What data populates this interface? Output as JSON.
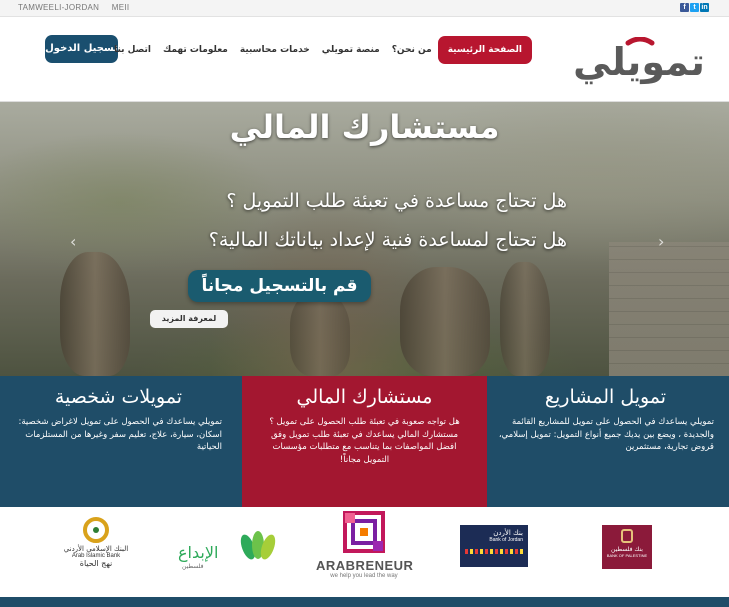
{
  "topbar": {
    "site_label": "TAMWEELI-JORDAN",
    "extra_label": "MEII",
    "social": [
      {
        "icon": "facebook-icon",
        "glyph": "f",
        "color": "#3b5998"
      },
      {
        "icon": "twitter-icon",
        "glyph": "t",
        "color": "#1da1f2"
      },
      {
        "icon": "linkedin-icon",
        "glyph": "in",
        "color": "#0077b5"
      }
    ]
  },
  "header": {
    "logo_text": "تمويلي",
    "nav": {
      "home": "الصفحة الرئيسية",
      "about": "من نحن؟",
      "platform": "منصة تمويلي",
      "accounting": "خدمات محاسبية",
      "info": "معلومات تهمك",
      "contact": "اتصل بنا"
    },
    "login": "تسجيل الدخول"
  },
  "hero": {
    "title": "مستشارك المالي",
    "question1": "هل تحتاج مساعدة في تعبئة طلب التمويل ؟",
    "question2": "هل تحتاج لمساعدة فنية لإعداد بياناتك المالية؟",
    "cta": "قم بالتسجيل مجاناً",
    "more": "لمعرفة المزيد",
    "prev_arrow": "‹",
    "next_arrow": "›"
  },
  "panels": {
    "projects": {
      "title": "تمويل المشاريع",
      "text": "تمويلي يساعدك في الحصول على تمويل للمشاريع القائمة والجديدة ، ويضع بين يديك جميع أنواع التمويل: تمويل إسلامي، قروض تجارية، مستثمرين"
    },
    "advisor": {
      "title": "مستشارك المالي",
      "text": "هل تواجه صعوبة في تعبئة طلب الحصول على تمويل ؟ مستشارك المالي يساعدك في تعبئة طلب تمويل وفق افضل المواصفات بما يتناسب مع متطلبات مؤسسات التمويل مجاناً!"
    },
    "personal": {
      "title": "تمويلات شخصية",
      "text": "تمويلي يساعدك في الحصول على تمويل لاغراض شخصية: اسكان، سيارة، علاج، تعليم سفر وغيرها من المستلزمات الحياتية"
    }
  },
  "partners": {
    "islamic_bank": {
      "name_ar": "البنك الإسلامي الأردني",
      "name_en": "Arab Islamic Bank",
      "tagline": "نهج الحياة"
    },
    "ibdaa": {
      "name": "الإبداع",
      "sub": "فلسطين"
    },
    "arabreneur": {
      "name": "ARABRENEUR",
      "tagline": "we help you lead the way"
    },
    "bank_jordan": {
      "name_ar": "بنك الأردن",
      "name_en": "Bank of Jordan"
    },
    "bank_palestine": {
      "name_ar": "بنك فلسطين",
      "name_en": "BANK OF PALESTINE"
    }
  }
}
